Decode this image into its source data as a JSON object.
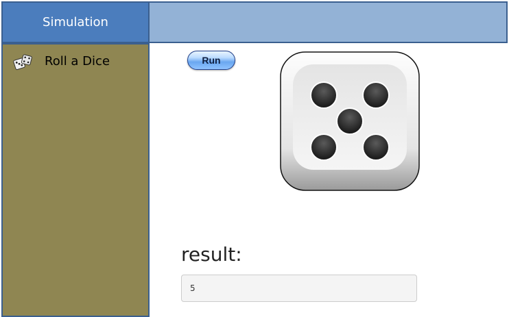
{
  "sidebar": {
    "header": "Simulation",
    "items": [
      {
        "label": "Roll a Dice",
        "icon": "dice-icon"
      }
    ]
  },
  "main": {
    "run_label": "Run",
    "dice_face": 5,
    "result_label": "result:",
    "result_value": "5"
  },
  "colors": {
    "sidebar_header": "#4b7dbd",
    "main_header": "#93b2d6",
    "sidebar_bg": "#8f8652",
    "border": "#3a5f8f"
  }
}
